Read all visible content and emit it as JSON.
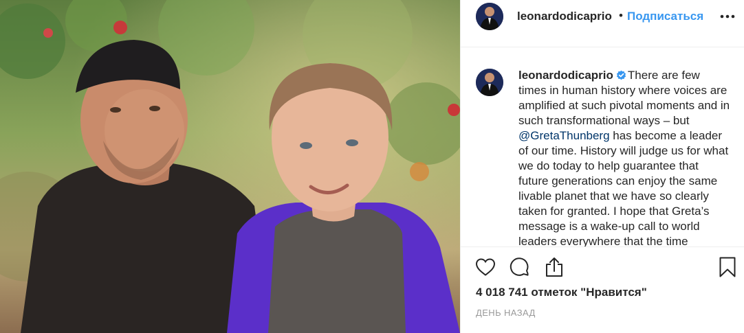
{
  "header": {
    "username": "leonardodicaprio",
    "separator": "•",
    "follow_label": "Подписаться",
    "more_icon": "more-horizontal-icon"
  },
  "caption": {
    "username": "leonardodicaprio",
    "verified_icon": "verified-badge-icon",
    "text_before_mention": "There are few times in human history where voices are amplified at such pivotal moments and in such transformational ways – but ",
    "mention": "@GretaThunberg",
    "text_after_mention": " has become a leader of our time. History will judge us for what we do today to help guarantee that future generations can enjoy the same livable planet that we have so clearly taken for granted. I hope that Greta’s message is a wake-up call to world leaders everywhere that the time"
  },
  "actions": {
    "like_icon": "heart-icon",
    "comment_icon": "comment-bubble-icon",
    "share_icon": "share-icon",
    "save_icon": "bookmark-icon"
  },
  "likes": "4 018 741 отметок \"Нравится\"",
  "timestamp": "ДЕНЬ НАЗАД",
  "colors": {
    "link": "#3897f0",
    "mention": "#003569",
    "text": "#262626",
    "muted": "#999999",
    "verified": "#3897f0"
  }
}
